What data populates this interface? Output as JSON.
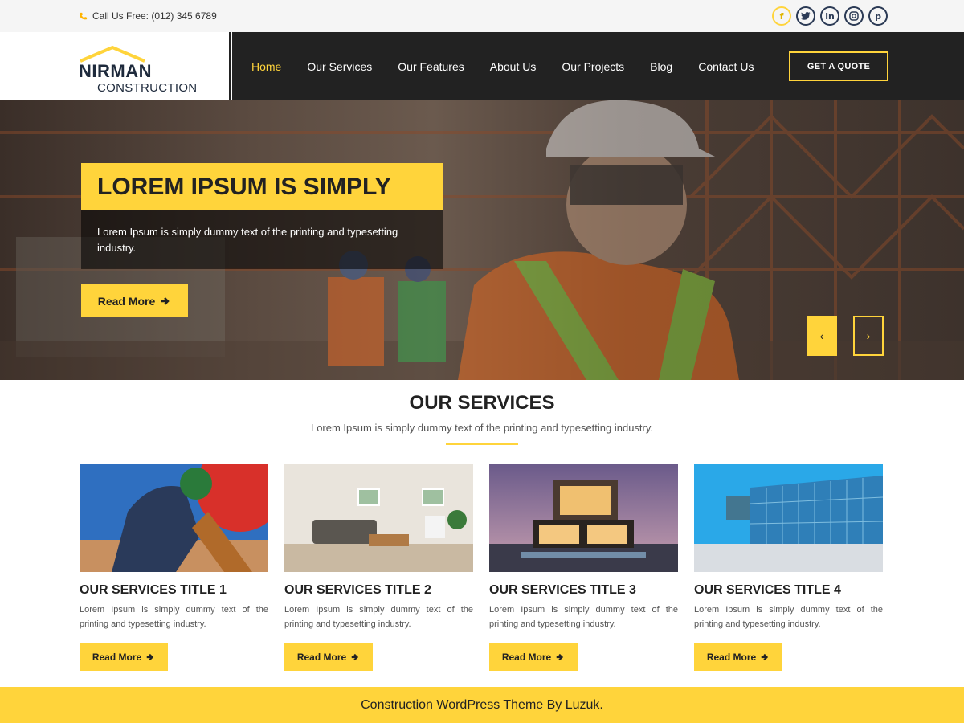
{
  "topbar": {
    "call_text": "Call Us Free: (012) 345 6789",
    "socials": [
      {
        "icon": "facebook-icon",
        "glyph": "f"
      },
      {
        "icon": "twitter-icon",
        "glyph": "t"
      },
      {
        "icon": "linkedin-icon",
        "glyph": "in"
      },
      {
        "icon": "instagram-icon",
        "glyph": "◎"
      },
      {
        "icon": "pinterest-icon",
        "glyph": "p"
      }
    ]
  },
  "logo": {
    "line1": "NIRMAN",
    "line2": "CONSTRUCTION"
  },
  "nav": {
    "items": [
      "Home",
      "Our Services",
      "Our Features",
      "About Us",
      "Our Projects",
      "Blog",
      "Contact Us"
    ],
    "active": "Home",
    "quote_label": "GET A QUOTE"
  },
  "hero": {
    "title": "LOREM IPSUM IS SIMPLY",
    "text": "Lorem Ipsum is simply dummy text of the printing and typesetting industry.",
    "button_label": "Read More",
    "prev_glyph": "‹",
    "next_glyph": "›"
  },
  "services": {
    "title": "OUR SERVICES",
    "subtitle": "Lorem Ipsum is simply dummy text of the printing and typesetting industry.",
    "cards": [
      {
        "title": "OUR SERVICES TITLE 1",
        "text": "Lorem Ipsum is simply dummy text of the printing and typesetting industry.",
        "button": "Read More"
      },
      {
        "title": "OUR SERVICES TITLE 2",
        "text": "Lorem Ipsum is simply dummy text of the printing and typesetting industry.",
        "button": "Read More"
      },
      {
        "title": "OUR SERVICES TITLE 3",
        "text": "Lorem Ipsum is simply dummy text of the printing and typesetting industry.",
        "button": "Read More"
      },
      {
        "title": "OUR SERVICES TITLE 4",
        "text": "Lorem Ipsum is simply dummy text of the printing and typesetting industry.",
        "button": "Read More"
      }
    ]
  },
  "footer": {
    "text": "Construction WordPress Theme By Luzuk."
  },
  "colors": {
    "accent": "#ffd43b",
    "dark": "#222222",
    "topbar": "#f5f5f5"
  }
}
